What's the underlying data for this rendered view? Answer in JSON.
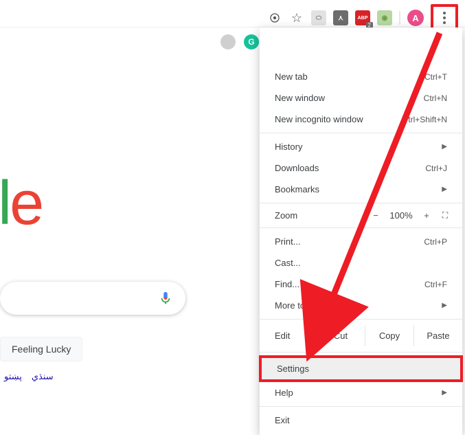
{
  "toolbar": {
    "adblock_badge": "2",
    "profile_initial": "A"
  },
  "page": {
    "logo_fragment": "gle",
    "lucky_button": "Feeling Lucky",
    "languages": [
      "پښتو",
      "سنڌي"
    ]
  },
  "menu": {
    "new_tab": {
      "label": "New tab",
      "shortcut": "Ctrl+T"
    },
    "new_window": {
      "label": "New window",
      "shortcut": "Ctrl+N"
    },
    "new_incognito": {
      "label": "New incognito window",
      "shortcut": "trl+Shift+N"
    },
    "history": {
      "label": "History"
    },
    "downloads": {
      "label": "Downloads",
      "shortcut": "Ctrl+J"
    },
    "bookmarks": {
      "label": "Bookmarks"
    },
    "zoom": {
      "label": "Zoom",
      "minus": "−",
      "value": "100%",
      "plus": "+"
    },
    "print": {
      "label": "Print...",
      "shortcut": "Ctrl+P"
    },
    "cast": {
      "label": "Cast..."
    },
    "find": {
      "label": "Find...",
      "shortcut": "Ctrl+F"
    },
    "more_tools": {
      "label": "More tools"
    },
    "edit": {
      "label": "Edit",
      "cut": "Cut",
      "copy": "Copy",
      "paste": "Paste"
    },
    "settings": {
      "label": "Settings"
    },
    "help": {
      "label": "Help"
    },
    "exit": {
      "label": "Exit"
    }
  }
}
